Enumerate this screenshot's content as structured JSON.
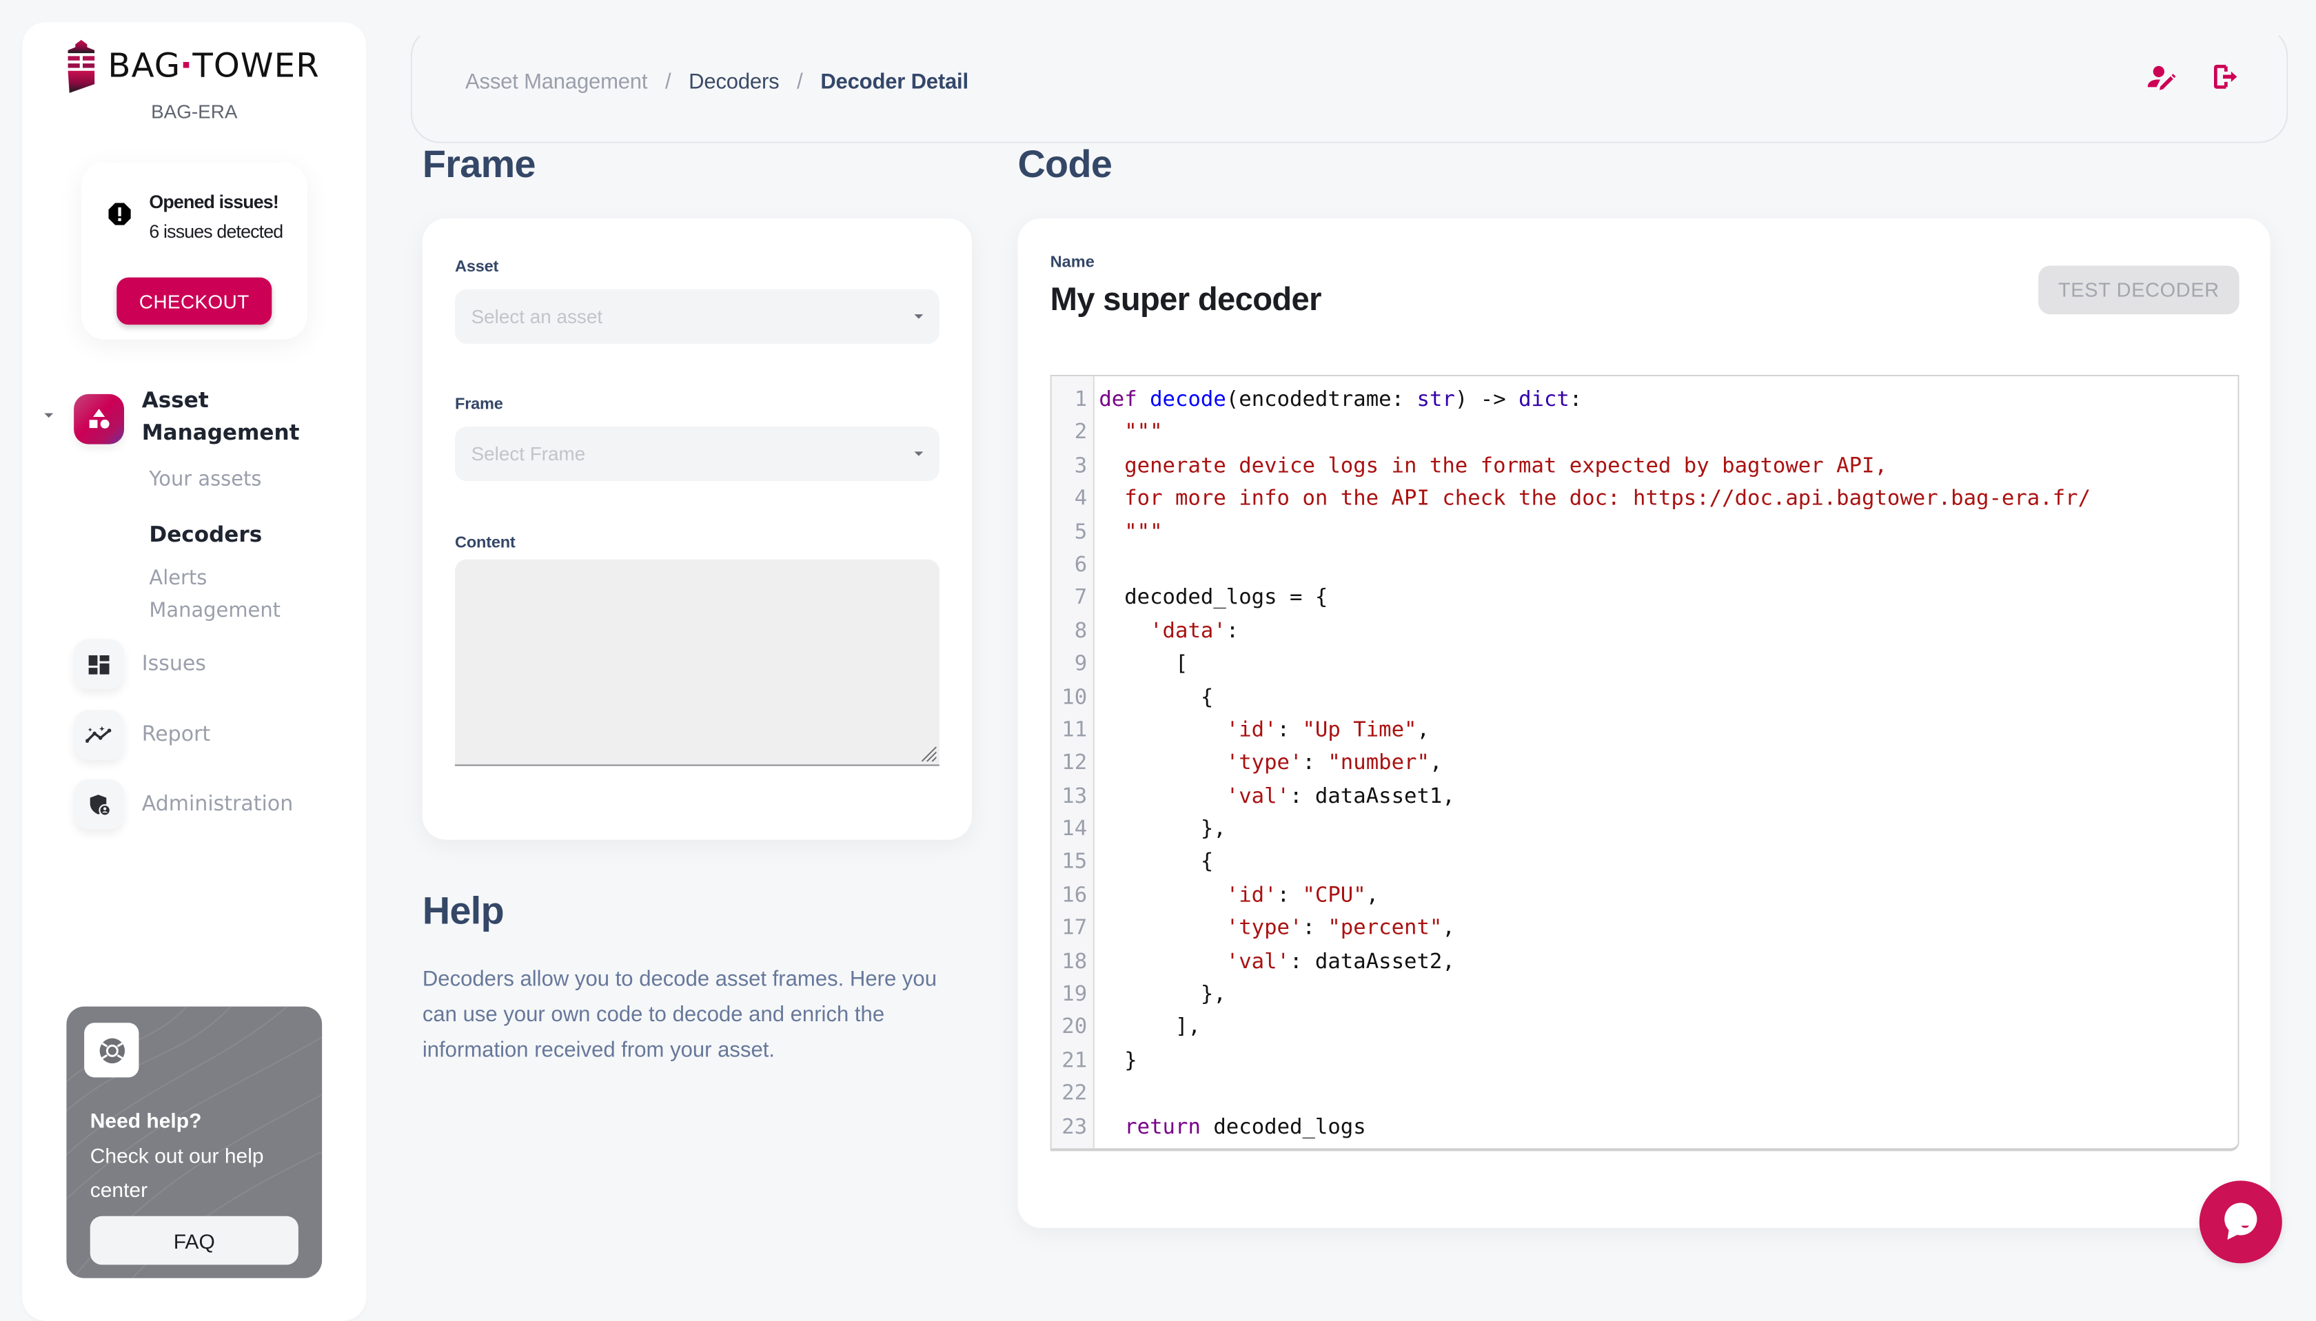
{
  "brand": {
    "name_left": "BAG",
    "name_right": "TOWER",
    "organization": "BAG-ERA",
    "accent_color": "#cc0055"
  },
  "issues_alert": {
    "icon": "alert-octagon-icon",
    "title": "Opened issues!",
    "subtitle": "6 issues detected",
    "button_label": "CHECKOUT"
  },
  "sidebar": {
    "sections": [
      {
        "label": "Asset Management",
        "icon": "shapes-icon",
        "expanded": true,
        "active": true,
        "children": [
          {
            "label": "Your assets",
            "active": false
          },
          {
            "label": "Decoders",
            "active": true
          },
          {
            "label": "Alerts Management",
            "active": false
          }
        ]
      },
      {
        "label": "Issues",
        "icon": "dashboard-icon",
        "active": false
      },
      {
        "label": "Report",
        "icon": "insights-icon",
        "active": false
      },
      {
        "label": "Administration",
        "icon": "admin-shield-icon",
        "active": false
      }
    ]
  },
  "help_card": {
    "icon": "lifebuoy-icon",
    "title": "Need help?",
    "subtitle": "Check out our help center",
    "button_label": "FAQ"
  },
  "header": {
    "breadcrumb": [
      "Asset Management",
      "Decoders",
      "Decoder Detail"
    ],
    "separator": "/",
    "actions": [
      {
        "icon": "user-edit-icon"
      },
      {
        "icon": "logout-icon"
      }
    ]
  },
  "frame_section": {
    "title": "Frame",
    "asset_field": {
      "label": "Asset",
      "placeholder": "Select an asset",
      "value": ""
    },
    "frame_field": {
      "label": "Frame",
      "placeholder": "Select Frame",
      "value": ""
    },
    "content_field": {
      "label": "Content",
      "value": ""
    }
  },
  "help_section": {
    "title": "Help",
    "body": "Decoders allow you to decode asset frames. Here you can use your own code to decode and enrich the information received from your asset."
  },
  "code_section": {
    "title": "Code",
    "name_label": "Name",
    "decoder_name": "My super decoder",
    "test_button_label": "TEST DECODER",
    "test_button_disabled": true,
    "language": "python",
    "lines": [
      [
        [
          "kw",
          "def"
        ],
        [
          "",
          "",
          " "
        ],
        [
          "def",
          "decode"
        ],
        [
          "",
          "(encodedtrame: "
        ],
        [
          "builtin",
          "str"
        ],
        [
          "",
          ") -> "
        ],
        [
          "builtin",
          "dict"
        ],
        [
          "",
          ":"
        ]
      ],
      [
        [
          "",
          "  "
        ],
        [
          "str",
          "\"\"\""
        ]
      ],
      [
        [
          "",
          "  "
        ],
        [
          "str",
          "generate device logs in the format expected by bagtower API,"
        ]
      ],
      [
        [
          "",
          "  "
        ],
        [
          "str",
          "for more info on the API check the doc: https://doc.api.bagtower.bag-era.fr/"
        ]
      ],
      [
        [
          "",
          "  "
        ],
        [
          "str",
          "\"\"\""
        ]
      ],
      [],
      [
        [
          "",
          "  decoded_logs = {"
        ]
      ],
      [
        [
          "",
          "    "
        ],
        [
          "str",
          "'data'"
        ],
        [
          "",
          ":"
        ]
      ],
      [
        [
          "",
          "      ["
        ]
      ],
      [
        [
          "",
          "        {"
        ]
      ],
      [
        [
          "",
          "          "
        ],
        [
          "str",
          "'id'"
        ],
        [
          "",
          ": "
        ],
        [
          "str",
          "\"Up Time\""
        ],
        [
          "",
          ","
        ]
      ],
      [
        [
          "",
          "          "
        ],
        [
          "str",
          "'type'"
        ],
        [
          "",
          ": "
        ],
        [
          "str",
          "\"number\""
        ],
        [
          "",
          ","
        ]
      ],
      [
        [
          "",
          "          "
        ],
        [
          "str",
          "'val'"
        ],
        [
          "",
          ": dataAsset1,"
        ]
      ],
      [
        [
          "",
          "        },"
        ]
      ],
      [
        [
          "",
          "        {"
        ]
      ],
      [
        [
          "",
          "          "
        ],
        [
          "str",
          "'id'"
        ],
        [
          "",
          ": "
        ],
        [
          "str",
          "\"CPU\""
        ],
        [
          "",
          ","
        ]
      ],
      [
        [
          "",
          "          "
        ],
        [
          "str",
          "'type'"
        ],
        [
          "",
          ": "
        ],
        [
          "str",
          "\"percent\""
        ],
        [
          "",
          ","
        ]
      ],
      [
        [
          "",
          "          "
        ],
        [
          "str",
          "'val'"
        ],
        [
          "",
          ": dataAsset2,"
        ]
      ],
      [
        [
          "",
          "        },"
        ]
      ],
      [
        [
          "",
          "      ],"
        ]
      ],
      [
        [
          "",
          "  }"
        ]
      ],
      [],
      [
        [
          "",
          "  "
        ],
        [
          "kw",
          "return"
        ],
        [
          "",
          " decoded_logs"
        ]
      ]
    ]
  },
  "chat_widget": {
    "icon": "chat-bubble-icon"
  }
}
